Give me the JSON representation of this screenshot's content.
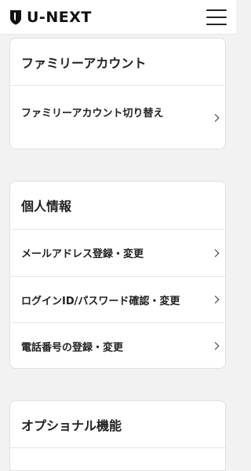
{
  "header": {
    "logo_text": "U-NEXT",
    "menu_icon": "hamburger-icon"
  },
  "sections": {
    "family": {
      "title": "ファミリーアカウント",
      "items": [
        {
          "label": "ファミリーアカウント切り替え"
        }
      ]
    },
    "personal": {
      "title": "個人情報",
      "items": [
        {
          "label": "メールアドレス登録・変更"
        },
        {
          "label": "ログインID/パスワード確認・変更"
        },
        {
          "label": "電話番号の登録・変更"
        }
      ]
    },
    "optional": {
      "title": "オプショナル機能"
    }
  }
}
